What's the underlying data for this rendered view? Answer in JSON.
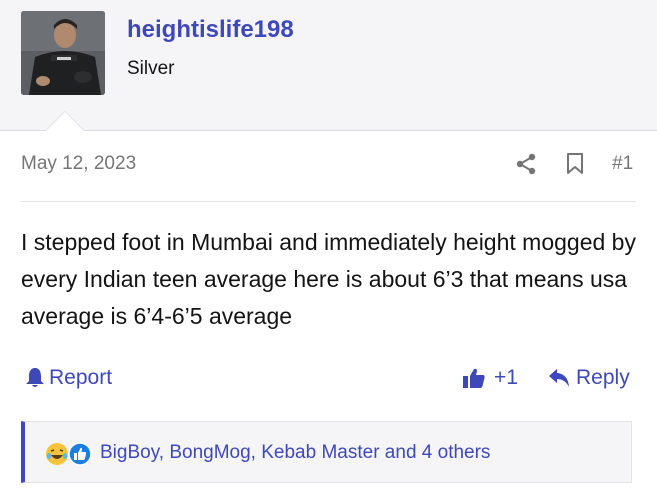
{
  "user": {
    "name": "heightislife198",
    "title": "Silver",
    "avatar_icon": "profile-photo"
  },
  "post": {
    "date": "May 12, 2023",
    "number": "#1",
    "body": "I stepped foot in Mumbai and immediately height mogged by every Indian teen average here is about 6’3 that means usa average is 6’4-6’5 average"
  },
  "actions": {
    "report_label": "Report",
    "like_count": "+1",
    "reply_label": "Reply"
  },
  "reactions": {
    "text": "BigBoy, BongMog, Kebab Master and 4 others"
  },
  "colors": {
    "accent": "#3f48b8",
    "muted": "#757575",
    "header_bg": "#f5f5f7"
  }
}
